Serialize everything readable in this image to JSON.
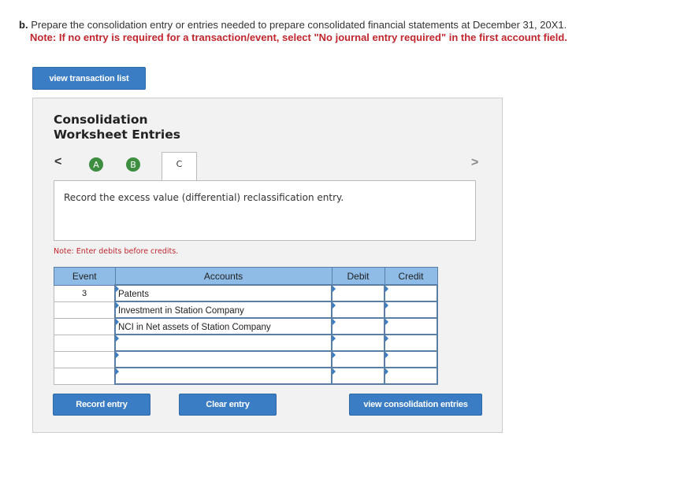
{
  "instruction": {
    "part_label": "b.",
    "text": "Prepare the consolidation entry or entries needed to prepare consolidated financial statements at December 31, 20X1.",
    "note": "Note: If no entry is required for a transaction/event, select \"No journal entry required\" in the first account field."
  },
  "view_transaction_list": "view transaction list",
  "panel": {
    "title_line1": "Consolidation",
    "title_line2": "Worksheet Entries",
    "nav_prev": "<",
    "nav_next": ">",
    "tabs": [
      {
        "label": "A",
        "completed": true
      },
      {
        "label": "B",
        "completed": true
      },
      {
        "label": "C",
        "active": true
      }
    ],
    "description": "Record the excess value (differential) reclassification entry.",
    "note": "Note: Enter debits before credits.",
    "table": {
      "headers": {
        "event": "Event",
        "accounts": "Accounts",
        "debit": "Debit",
        "credit": "Credit"
      },
      "rows": [
        {
          "event": "3",
          "account": "Patents",
          "debit": "",
          "credit": ""
        },
        {
          "event": "",
          "account": "Investment in Station Company",
          "debit": "",
          "credit": ""
        },
        {
          "event": "",
          "account": "NCI in Net assets of Station Company",
          "debit": "",
          "credit": ""
        },
        {
          "event": "",
          "account": "",
          "debit": "",
          "credit": ""
        },
        {
          "event": "",
          "account": "",
          "debit": "",
          "credit": ""
        },
        {
          "event": "",
          "account": "",
          "debit": "",
          "credit": ""
        }
      ]
    }
  },
  "buttons": {
    "record": "Record entry",
    "clear": "Clear entry",
    "view_consolidation": "view consolidation entries"
  },
  "colors": {
    "accent": "#3b7dc4",
    "note_red": "#c0262d",
    "completed_tab": "#3e8e41",
    "header_bg": "#8ebce6"
  }
}
